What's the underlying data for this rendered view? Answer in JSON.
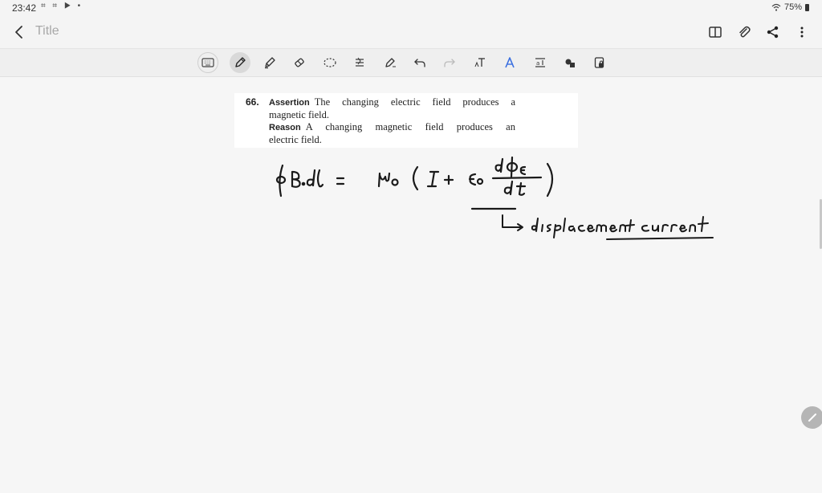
{
  "status_bar": {
    "time": "23:42",
    "notification_icons": "⌗ ⌗ ▶ •",
    "battery": "75%"
  },
  "header": {
    "title_placeholder": "Title",
    "actions": [
      "book-icon",
      "paperclip-icon",
      "share-icon",
      "more-icon"
    ]
  },
  "toolbar": {
    "tools": [
      "keyboard-icon",
      "pen-icon",
      "highlighter-icon",
      "eraser-icon",
      "lasso-icon",
      "line-style-icon",
      "shape-pen-icon",
      "undo-icon",
      "redo-icon",
      "text-icon",
      "ai-icon",
      "text-box-icon",
      "shapes-icon",
      "read-only-icon"
    ],
    "active_tool": "pen-icon"
  },
  "note": {
    "question": {
      "number": "66.",
      "assertion_label": "Assertion",
      "assertion_line1": "The changing electric field produces a",
      "assertion_line2": "magnetic field.",
      "reason_label": "Reason",
      "reason_line1": "A changing magnetic field produces an",
      "reason_line2": "electric field."
    },
    "handwriting": {
      "equation": "∮B.dl = μ₀ ( I + ε₀ dΦE/dt )",
      "annotation": "↳ displacement current"
    }
  }
}
